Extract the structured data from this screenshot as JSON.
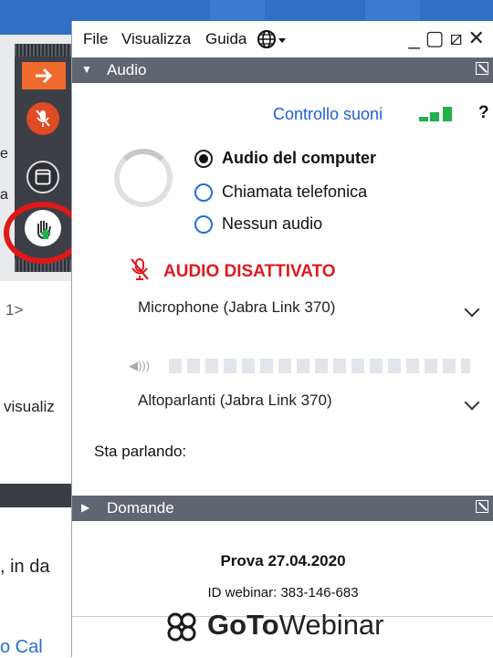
{
  "background": {
    "snippets": [
      "e",
      "a",
      "1>",
      "visualiz",
      ", in da"
    ],
    "link_text": "o Cal"
  },
  "menu": {
    "file": "File",
    "view": "Visualizza",
    "help": "Guida"
  },
  "window_controls": "_▢⧄✕",
  "audio_section": {
    "title": "Audio",
    "sound_control": "Controllo suoni",
    "help_symbol": "?",
    "options": [
      "Audio del computer",
      "Chiamata telefonica",
      "Nessun audio"
    ],
    "selected_option": "Audio del computer",
    "muted_label": "AUDIO DISATTIVATO",
    "microphone": "Microphone (Jabra Link 370)",
    "speakers": "Altoparlanti (Jabra Link 370)",
    "speaking_label": "Sta parlando:"
  },
  "questions_section": {
    "title": "Domande"
  },
  "webinar": {
    "name": "Prova 27.04.2020",
    "id": "ID webinar: 383-146-683",
    "brand_goto": "GoTo",
    "brand_webinar": "Webinar"
  },
  "colors": {
    "accent_orange": "#ef6a2d",
    "mute_red": "#e0191e",
    "link_blue": "#1f5fd0",
    "meter_green": "#1fb14a",
    "highlight_circle": "#e01818"
  }
}
